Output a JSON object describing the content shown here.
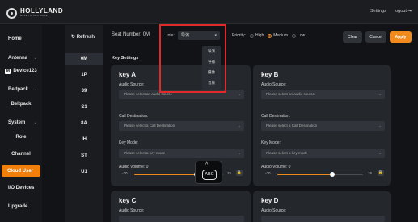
{
  "brand": {
    "name": "HOLLYLAND",
    "tagline": "MAKE TO TALK MORE"
  },
  "header": {
    "settings": "Settings",
    "logout": "logout"
  },
  "sidebar": {
    "items": [
      {
        "label": "Home",
        "chevron": false
      },
      {
        "label": "Antenna",
        "chevron": true
      },
      {
        "label": "Device123",
        "sub": true,
        "badge": "M"
      },
      {
        "label": "Beltpack",
        "chevron": true
      },
      {
        "label": "Beltpack",
        "sub": true
      },
      {
        "label": "System",
        "chevron": true
      },
      {
        "label": "Role",
        "sub": true
      },
      {
        "label": "Channel",
        "sub": true
      },
      {
        "label": "Cloud User",
        "active": true
      },
      {
        "label": "I/O Devices"
      },
      {
        "label": "Upgrade"
      }
    ]
  },
  "devices": {
    "refresh_label": "Refresh",
    "items": [
      "0M",
      "1P",
      "39",
      "S1",
      "8A",
      "IH",
      "ST",
      "U1"
    ],
    "selected": "0M"
  },
  "seat": {
    "label": "Seat Number:",
    "value": "0M",
    "role_label": "role:",
    "role_value": "导演",
    "role_options": [
      "导演",
      "导播",
      "摄像",
      "音频"
    ],
    "priority_label": "Priority:",
    "priority_options": [
      "High",
      "Medium",
      "Low"
    ],
    "priority_selected": "Medium"
  },
  "actions": {
    "clear": "Clear",
    "cancel": "Cancel",
    "apply": "Apply"
  },
  "key_settings": {
    "title": "Key Settings",
    "audio_source_label": "Audio Source:",
    "audio_source_placeholder": "Please select an audio source",
    "call_destination_label": "Call Destination:",
    "call_destination_placeholder": "Please select a Call Destination",
    "key_mode_label": "Key Mode:",
    "key_mode_placeholder": "Please select a key mode",
    "volume_label": "Audio Volume:",
    "keys": [
      {
        "name": "key A",
        "volume": "0",
        "min": "-30",
        "max": "15"
      },
      {
        "name": "key B",
        "volume": "0",
        "min": "-30",
        "max": "15"
      },
      {
        "name": "key C"
      },
      {
        "name": "key D"
      }
    ]
  },
  "keyboard_popup": {
    "label": "ABC"
  },
  "colors": {
    "accent": "#f08a1c",
    "highlight": "#e12b2b",
    "background": "#111316"
  }
}
